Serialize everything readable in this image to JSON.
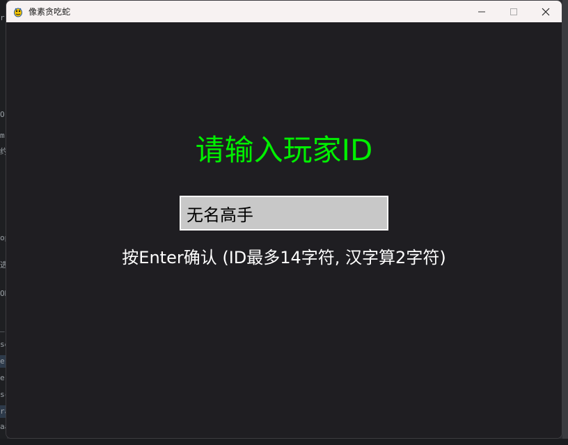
{
  "window": {
    "title": "像素贪吃蛇",
    "controls": {
      "minimize": "—",
      "maximize": "☐",
      "close": "✕"
    }
  },
  "screen": {
    "heading": "请输入玩家ID",
    "input_value": "无名高手",
    "hint": "按Enter确认 (ID最多14字符, 汉字算2字符)"
  },
  "background_editor": {
    "edge_glyphs": [
      "r",
      "O",
      "m",
      "约",
      "op",
      "选",
      "ON",
      "_(",
      "se",
      "e",
      "e",
      "sc",
      "ra",
      "aa"
    ]
  },
  "colors": {
    "heading": "#00f000",
    "canvas": "#1f1e22",
    "input_bg": "#c8c8c8",
    "titlebar": "#f7f2f2"
  }
}
